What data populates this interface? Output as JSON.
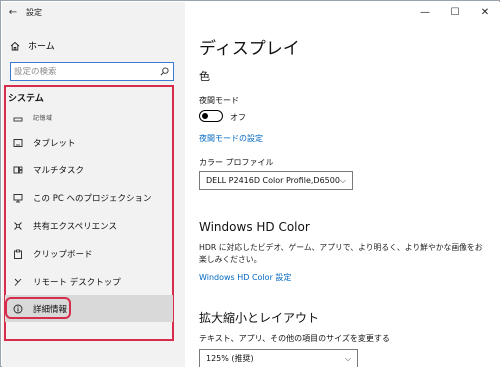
{
  "window": {
    "title": "設定"
  },
  "sidebar": {
    "home_label": "ホーム",
    "search_placeholder": "設定の検索",
    "section_title": "システム",
    "items": [
      {
        "label": "記憶域",
        "icon": "storage-icon"
      },
      {
        "label": "タブレット",
        "icon": "tablet-icon"
      },
      {
        "label": "マルチタスク",
        "icon": "multitask-icon"
      },
      {
        "label": "この PC へのプロジェクション",
        "icon": "projection-icon"
      },
      {
        "label": "共有エクスペリエンス",
        "icon": "shared-experience-icon"
      },
      {
        "label": "クリップボード",
        "icon": "clipboard-icon"
      },
      {
        "label": "リモート デスクトップ",
        "icon": "remote-desktop-icon"
      },
      {
        "label": "詳細情報",
        "icon": "info-icon",
        "selected": true
      }
    ]
  },
  "main": {
    "title": "ディスプレイ",
    "color_heading": "色",
    "night_light_label": "夜間モード",
    "night_light_state": "オフ",
    "night_light_on": false,
    "night_light_settings_link": "夜間モードの設定",
    "color_profile_label": "カラー プロファイル",
    "color_profile_value": "DELL P2416D Color Profile,D6500",
    "hd_color_heading": "Windows HD Color",
    "hd_color_description": "HDR に対応したビデオ、ゲーム、アプリで、より明るく、より鮮やかな画像をお楽しみください。",
    "hd_color_link": "Windows HD Color 設定",
    "scale_heading": "拡大縮小とレイアウト",
    "scale_label": "テキスト、アプリ、その他の項目のサイズを変更する",
    "scale_value": "125% (推奨)"
  },
  "colors": {
    "accent": "#0067c0",
    "highlight_border": "#d72c4c",
    "sidebar_bg": "#f2f2f2",
    "selected_bg": "#d9d9d9"
  }
}
